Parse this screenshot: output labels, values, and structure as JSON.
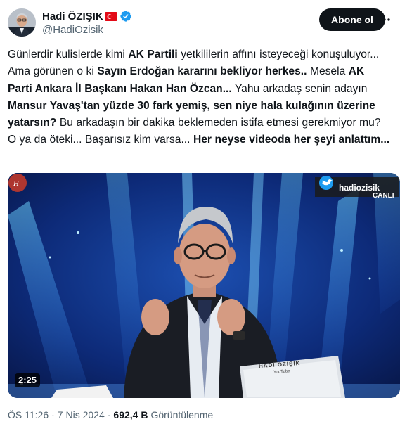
{
  "author": {
    "display_name": "Hadi ÖZIŞIK",
    "handle": "@HadiOzisik",
    "flag": "turkey-flag",
    "verified_icon": "verified-badge-icon"
  },
  "actions": {
    "follow_label": "Abone ol",
    "more_icon": "more-icon"
  },
  "tweet": {
    "segments": [
      {
        "text": "Günlerdir kulislerde kimi ",
        "bold": false
      },
      {
        "text": "AK Partili",
        "bold": true
      },
      {
        "text": " yetkililerin affını isteyeceği konuşuluyor... Ama görünen o ki ",
        "bold": false
      },
      {
        "text": "Sayın Erdoğan kararını bekliyor herkes..",
        "bold": true
      },
      {
        "text": " Mesela ",
        "bold": false
      },
      {
        "text": "AK Parti Ankara İl Başkanı Hakan Han Özcan...",
        "bold": true
      },
      {
        "text": " Yahu arkadaş senin adayın ",
        "bold": false
      },
      {
        "text": "Mansur Yavaş'tan yüzde 30 fark yemiş, sen niye hala kulağının üzerine yatarsın?",
        "bold": true
      },
      {
        "text": " Bu arkadaşın bir dakika beklemeden istifa etmesi gerekmiyor mu? O ya da öteki... Başarısız kim varsa... ",
        "bold": false
      },
      {
        "text": "Her neyse videoda her şeyi anlattım...",
        "bold": true
      }
    ]
  },
  "video": {
    "duration": "2:25",
    "channel_name": "hadiozisik",
    "live_label": "CANLI",
    "laptop_label": "HADİ ÖZIŞIK",
    "laptop_sub": "YouTube"
  },
  "meta": {
    "time": "ÖS 11:26",
    "separator": "·",
    "date": "7 Nis 2024",
    "views": "692,4 B",
    "views_label": "Görüntülenme"
  },
  "colors": {
    "text_primary": "#0f1419",
    "text_secondary": "#536471",
    "verified_blue": "#1d9bf0",
    "button_dark": "#0f1419"
  }
}
